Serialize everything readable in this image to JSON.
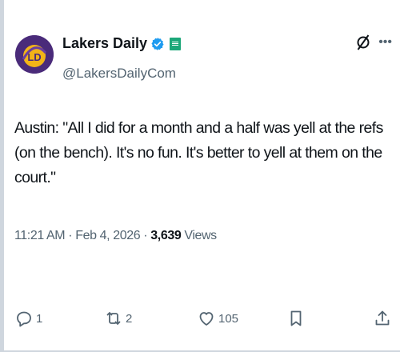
{
  "author": {
    "display_name": "Lakers Daily",
    "handle": "@LakersDailyCom",
    "avatar_text": "LD"
  },
  "post": {
    "text": "Austin: \"All I did for a month and a half was yell at the refs (on the bench). It's no fun. It's better to yell at them on the court.\"",
    "time": "11:21 AM",
    "date": "Feb 4, 2026",
    "separator": "·",
    "views_count": "3,639",
    "views_label": "Views"
  },
  "actions": {
    "replies": "1",
    "reposts": "2",
    "likes": "105"
  },
  "icons": {
    "verified": "verified-badge-icon",
    "affiliate": "affiliate-badge-icon",
    "grok": "grok-icon",
    "more": "more-icon",
    "reply": "reply-icon",
    "repost": "repost-icon",
    "like": "like-icon",
    "bookmark": "bookmark-icon",
    "share": "share-icon"
  },
  "colors": {
    "verified_blue": "#1d9bf0",
    "secondary_text": "#536471",
    "primary_text": "#0f1419",
    "affiliate_green": "#1ca779",
    "avatar_purple": "#4a2b7a",
    "avatar_gold": "#f2b418"
  }
}
